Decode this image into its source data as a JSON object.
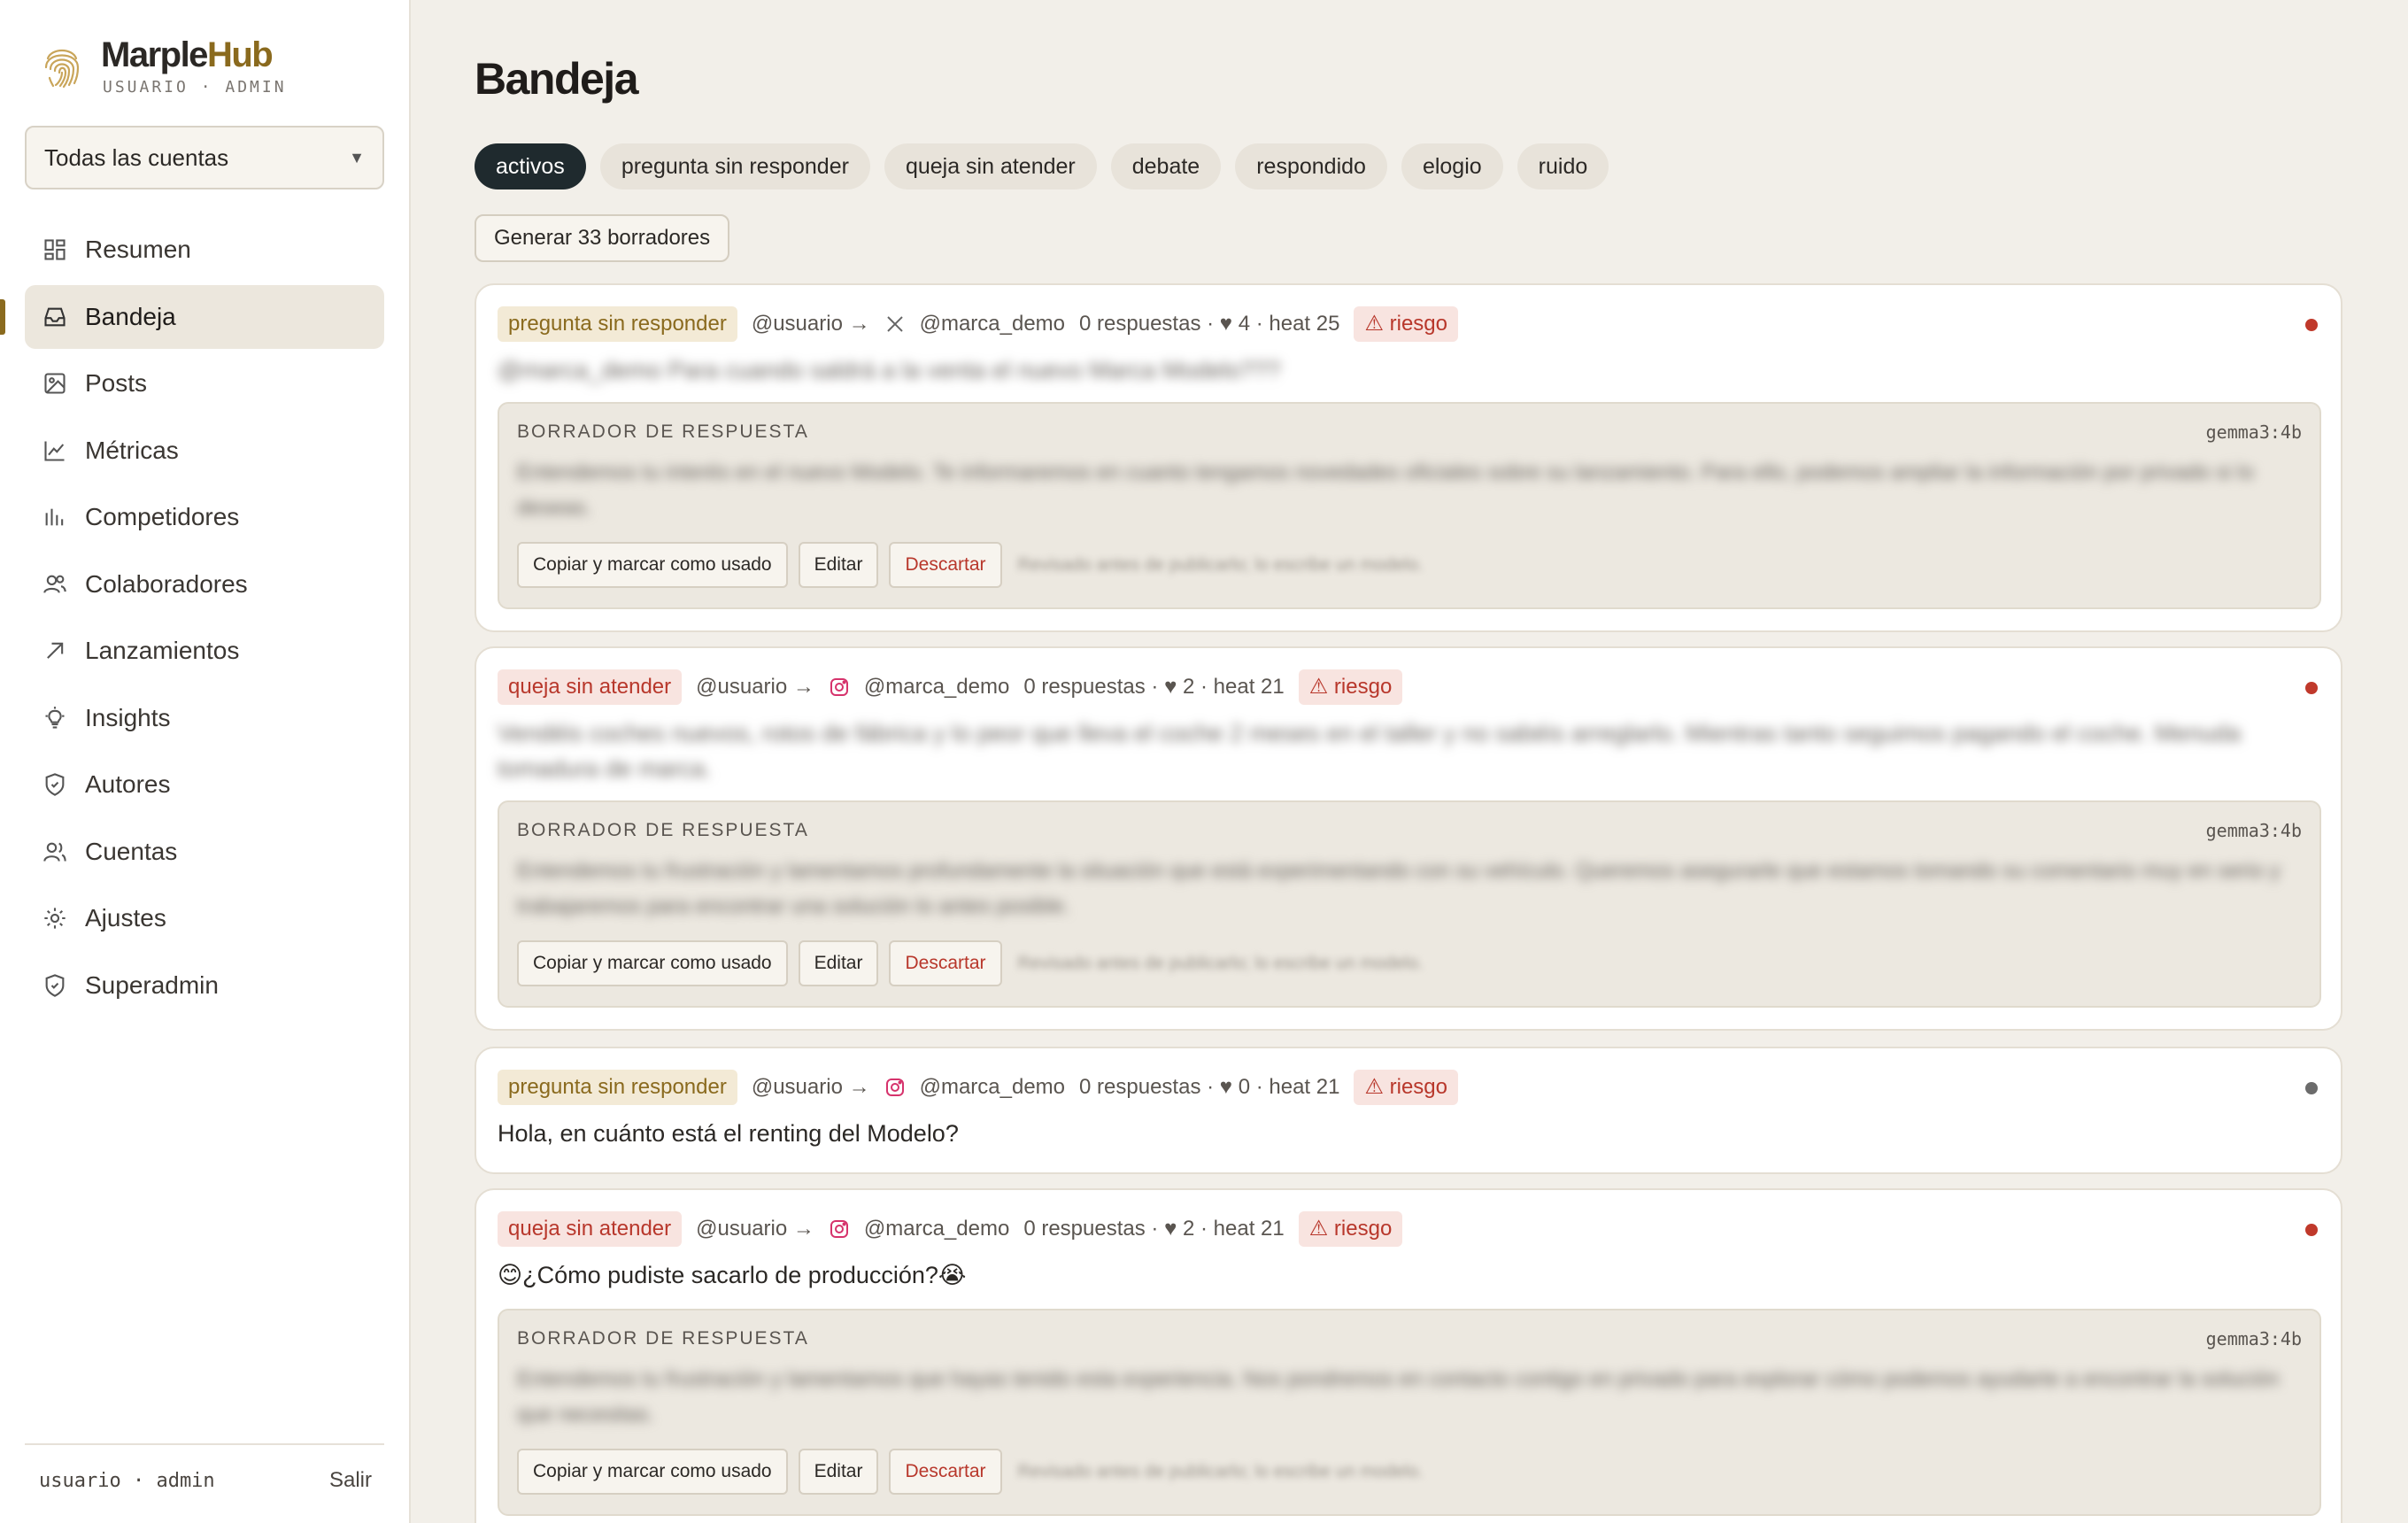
{
  "brand": {
    "name_main": "Marple",
    "name_accent": "Hub",
    "subtitle": "USUARIO · ADMIN"
  },
  "account_select": {
    "value": "Todas las cuentas"
  },
  "nav": [
    {
      "label": "Resumen",
      "icon": "dashboard-icon",
      "active": false
    },
    {
      "label": "Bandeja",
      "icon": "inbox-icon",
      "active": true
    },
    {
      "label": "Posts",
      "icon": "image-icon",
      "active": false
    },
    {
      "label": "Métricas",
      "icon": "line-chart-icon",
      "active": false
    },
    {
      "label": "Competidores",
      "icon": "bar-chart-icon",
      "active": false
    },
    {
      "label": "Colaboradores",
      "icon": "users-icon",
      "active": false
    },
    {
      "label": "Lanzamientos",
      "icon": "arrow-up-right-icon",
      "active": false
    },
    {
      "label": "Insights",
      "icon": "lightbulb-icon",
      "active": false
    },
    {
      "label": "Autores",
      "icon": "shield-icon",
      "active": false
    },
    {
      "label": "Cuentas",
      "icon": "user-group-icon",
      "active": false
    },
    {
      "label": "Ajustes",
      "icon": "gear-icon",
      "active": false
    },
    {
      "label": "Superadmin",
      "icon": "shield-check-icon",
      "active": false
    }
  ],
  "footer": {
    "user": "usuario · admin",
    "logout": "Salir"
  },
  "main": {
    "title": "Bandeja",
    "filters": [
      "activos",
      "pregunta sin responder",
      "queja sin atender",
      "debate",
      "respondido",
      "elogio",
      "ruido"
    ],
    "active_filter": "activos",
    "generate_button": "Generar 33 borradores"
  },
  "colors": {
    "accent": "#8a6a1e",
    "danger": "#b8372b",
    "active_chip": "#1f2a2e",
    "background": "#f2efe9"
  },
  "draft_labels": {
    "title": "BORRADOR DE RESPUESTA",
    "copy": "Copiar y marcar como usado",
    "edit": "Editar",
    "discard": "Descartar",
    "hint": "Revisado antes de publicarlo; lo escribe un modelo."
  },
  "cards": [
    {
      "tag": "pregunta sin responder",
      "tag_kind": "question",
      "from": "@usuario →",
      "network": "x-icon",
      "to": "@marca_demo",
      "stats": "0 respuestas · ♥ 4 · heat 25",
      "risk": "⚠ riesgo",
      "status": "red",
      "text": "@marca_demo Para cuando saldrá a la venta el nuevo Marca Modelo???",
      "blurred": true,
      "draft": {
        "model": "gemma3:4b",
        "text": "Entendemos tu interés en el nuevo Modelo. Te informaremos en cuanto tengamos novedades oficiales sobre su lanzamiento. Para ello, podemos ampliar la información por privado si lo deseas."
      }
    },
    {
      "tag": "queja sin atender",
      "tag_kind": "complaint",
      "from": "@usuario →",
      "network": "instagram-icon",
      "to": "@marca_demo",
      "stats": "0 respuestas · ♥ 2 · heat 21",
      "risk": "⚠ riesgo",
      "status": "red",
      "text": "Vendéis coches nuevos, rotos de fábrica y lo peor que lleva el coche 2 meses en el taller y no sabéis arreglarlo. Mientras tanto seguimos pagando el coche. Menuda tomadura de marca.",
      "blurred": true,
      "draft": {
        "model": "gemma3:4b",
        "text": "Entendemos tu frustración y lamentamos profundamente la situación que está experimentando con su vehículo. Queremos asegurarle que estamos tomando su comentario muy en serio y trabajaremos para encontrar una solución lo antes posible."
      }
    },
    {
      "tag": "pregunta sin responder",
      "tag_kind": "question",
      "from": "@usuario →",
      "network": "instagram-icon",
      "to": "@marca_demo",
      "stats": "0 respuestas · ♥ 0 · heat 21",
      "risk": "⚠ riesgo",
      "status": "gray",
      "text": "Hola, en cuánto está el renting del Modelo?",
      "blurred": false
    },
    {
      "tag": "queja sin atender",
      "tag_kind": "complaint",
      "from": "@usuario →",
      "network": "instagram-icon",
      "to": "@marca_demo",
      "stats": "0 respuestas · ♥ 2 · heat 21",
      "risk": "⚠ riesgo",
      "status": "red",
      "text": "😊¿Cómo pudiste sacarlo de producción?😭",
      "blurred": false,
      "draft": {
        "model": "gemma3:4b",
        "text": "Entendemos tu frustración y lamentamos que hayas tenido esta experiencia. Nos pondremos en contacto contigo en privado para explorar cómo podemos ayudarte a encontrar la solución que necesitas."
      }
    }
  ]
}
